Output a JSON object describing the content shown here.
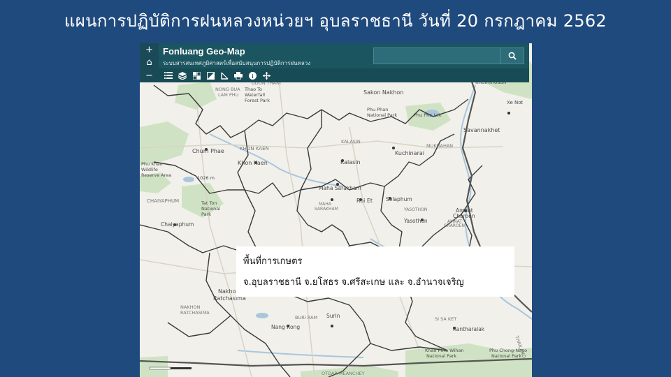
{
  "slide": {
    "title": "แผนการปฏิบัติการฝนหลวงหน่วยฯ อุบลราชธานี วันที่ 20 กรกฎาคม 2562"
  },
  "app": {
    "title": "Fonluang Geo-Map",
    "subtitle": "ระบบสารสนเทศภูมิศาสตร์เพื่อสนับสนุนการปฏิบัติการฝนหลวง"
  },
  "zoom": {
    "in_label": "+",
    "home_label": "⌂",
    "out_label": "−"
  },
  "search": {
    "placeholder": "",
    "value": ""
  },
  "toolbar": {
    "icons": [
      "list-icon",
      "layers-icon",
      "basemap-gallery-icon",
      "overview-icon",
      "measure-icon",
      "print-icon",
      "info-icon",
      "pan-icon"
    ],
    "info_glyph": "i"
  },
  "map": {
    "labels": {
      "nong_bua": "NONG BUA",
      "nong_bua2": "LAM PHU",
      "thao_to": "Thao To",
      "waterfall": "Waterfall",
      "forest_park": "Forest Park",
      "udon": "UDON THANI",
      "sakon": "Sakon Nakhon",
      "phu_phan": "Phu Phan",
      "national_park_pp": "National Park",
      "phu_pha_lek": "Phu Pha Lek",
      "chum_phae": "Chum Phae",
      "khon_kaen_prov": "KHON KAEN",
      "khon_kaen": "Khon Kaen",
      "kalasin_prov": "KALASIN",
      "kalasin": "Kalasin",
      "kuchinarai": "Kuchinarai",
      "mukdahan": "MUKDAHAN",
      "savannakhet": "Savannakhet",
      "xe_not": "Xe Not",
      "phu_khao": "Phu Khao",
      "wildlife": "Wildlife",
      "reserve_area": "Reserve Area",
      "elev": "1026 m",
      "maha_sarakham_city": "Maha Sarakham",
      "maha_prov": "MAHA",
      "sarakham_prov": "SARAKHAM",
      "roi_et": "Roi Et",
      "selaphum": "Selaphum",
      "yasothon_prov": "YASOTHON",
      "yasothon": "Yasothon",
      "amnat": "Amnat",
      "charoen": "Charoen",
      "amnat_prov": "AMNAT",
      "charoen_prov": "CHAROEN",
      "chaiyaphum_prov": "CHAIYAPHUM",
      "tat_ton": "Tat Ton",
      "national": "National",
      "park": "Park",
      "chaiyaphum": "Chaiyaphum",
      "nakhon": "Nakhon",
      "ratchasima": "Ratchasima",
      "nakhon_prov": "NAKHON",
      "ratchasima_prov": "RATCHASIMA",
      "buri_ram": "BURI RAM",
      "nang_rong": "Nang Rong",
      "surin": "Surin",
      "si_sa_ket": "SI SA KET",
      "kantharalak": "Kantharalak",
      "khao_phra_wihan": "Khao Phra Wihan",
      "national_park_kpw": "National Park",
      "phu_chong": "Phu Chong-Nayo",
      "national_park_pc": "National Park",
      "otdar": "OTDAR MEANCHEY",
      "khammouan": "Khammouan",
      "thailand": "THAILAND"
    }
  },
  "info_box": {
    "line1": "พื้นที่การเกษตร",
    "line2": "จ.อุบลราชธานี จ.ยโสธร จ.ศรีสะเกษ และ จ.อำนาจเจริญ"
  },
  "colors": {
    "slide_bg": "#1f4a7e",
    "header_bg": "#1b5560",
    "map_bg": "#f2f1ec",
    "forest": "#cfe3c4",
    "water": "#a9c6dc",
    "border": "#3a3a3a"
  }
}
